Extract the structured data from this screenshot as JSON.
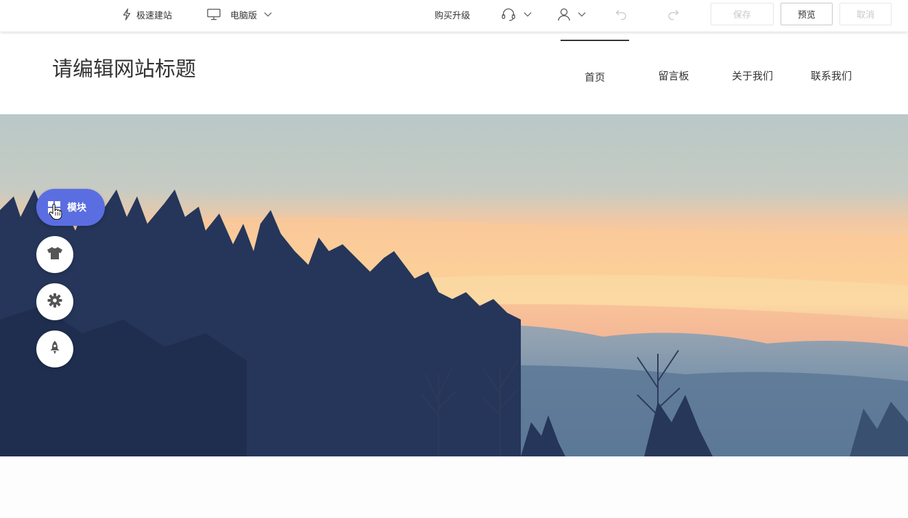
{
  "toolbar": {
    "quick_build_label": "极速建站",
    "device_label": "电脑版",
    "upgrade_label": "购买升级",
    "save_label": "保存",
    "preview_label": "预览",
    "cancel_label": "取消"
  },
  "site": {
    "title": "请编辑网站标题",
    "nav": [
      {
        "label": "首页",
        "active": true
      },
      {
        "label": "留言板",
        "active": false
      },
      {
        "label": "关于我们",
        "active": false
      },
      {
        "label": "联系我们",
        "active": false
      }
    ]
  },
  "float_tools": {
    "module_label": "模块",
    "icons": [
      "module-icon",
      "shirt-icon",
      "gear-icon",
      "rocket-icon"
    ]
  },
  "colors": {
    "module_accent": "#5b6ee1"
  }
}
